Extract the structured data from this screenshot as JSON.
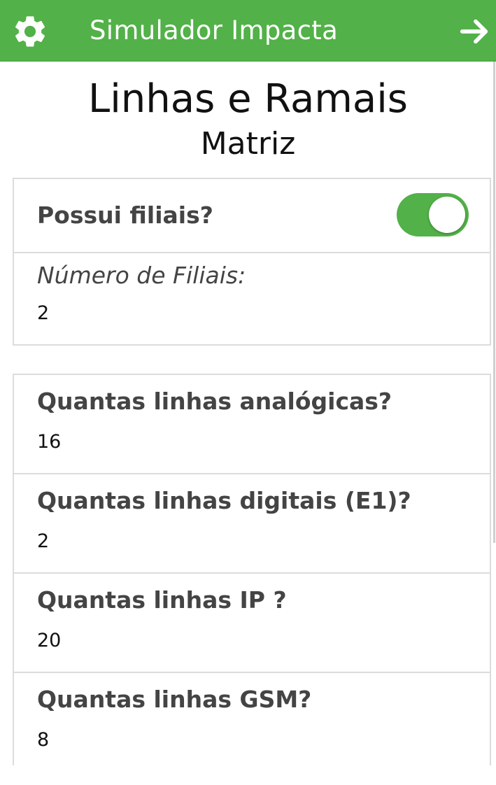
{
  "colors": {
    "accent": "#52b148",
    "header_text": "#ffffff"
  },
  "header": {
    "left_icon": "gear-icon",
    "title": "Simulador Impacta",
    "right_icon": "arrow-right-icon"
  },
  "page": {
    "title": "Linhas e Ramais",
    "subtitle": "Matriz"
  },
  "branch_settings": {
    "has_branches_label": "Possui filiais?",
    "has_branches_on": true,
    "branch_count_label": "Número de Filiais:",
    "branch_count_value": "2"
  },
  "lines": [
    {
      "label": "Quantas linhas analógicas?",
      "value": "16"
    },
    {
      "label": "Quantas linhas digitais (E1)?",
      "value": "2"
    },
    {
      "label": "Quantas linhas IP ?",
      "value": "20"
    },
    {
      "label": "Quantas linhas GSM?",
      "value": "8"
    }
  ]
}
